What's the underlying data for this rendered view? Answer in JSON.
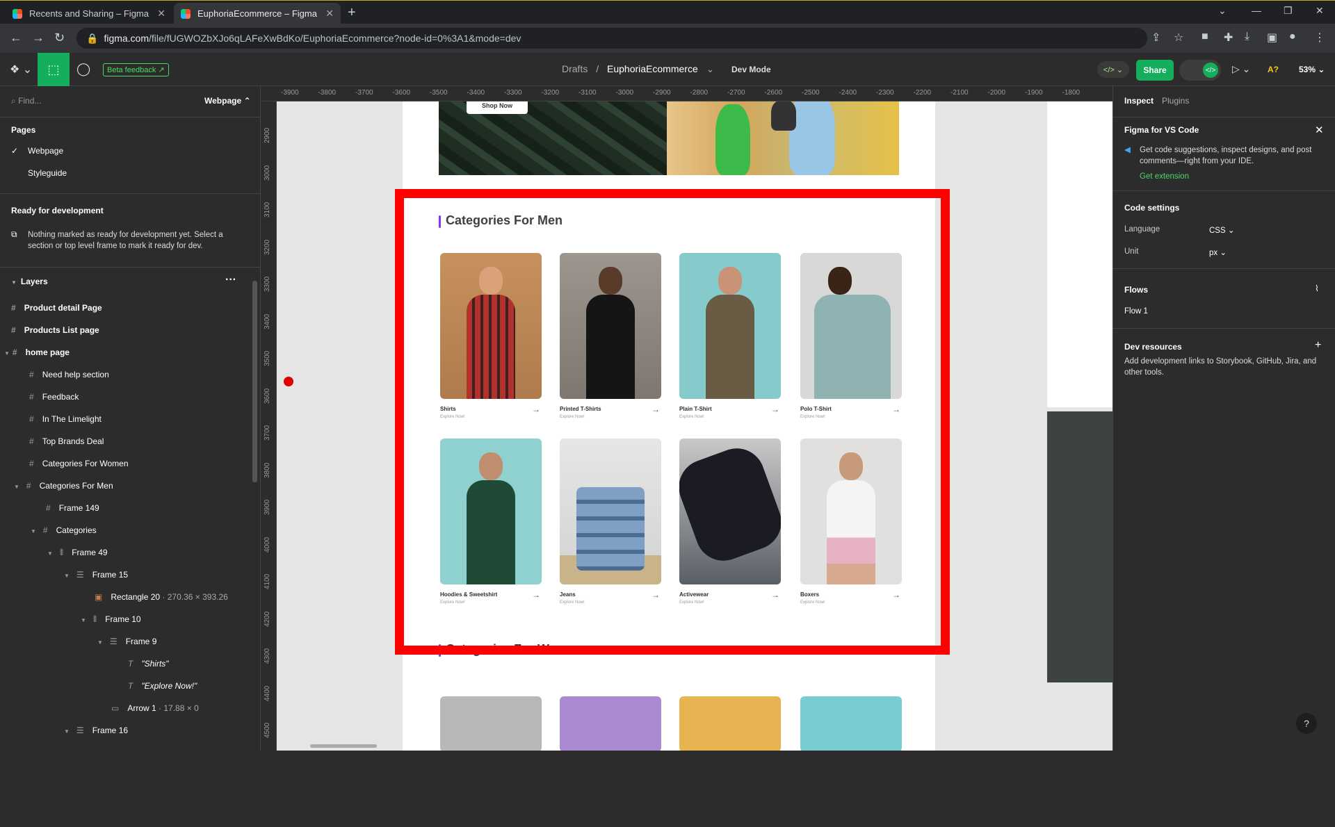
{
  "browser": {
    "tabs": [
      {
        "label": "Recents and Sharing – Figma"
      },
      {
        "label": "EuphoriaEcommerce – Figma"
      }
    ],
    "url_host": "figma.com",
    "url_path": "/file/fUGWOZbXJo6qLAFeXwBdKo/EuphoriaEcommerce?node-id=0%3A1&mode=dev"
  },
  "toolbar": {
    "beta_feedback": "Beta feedback",
    "breadcrumb_drafts": "Drafts",
    "breadcrumb_sep": "/",
    "file_name": "EuphoriaEcommerce",
    "dev_mode": "Dev Mode",
    "share": "Share",
    "zoom": "53%",
    "a11y": "A?"
  },
  "left_panel": {
    "find_placeholder": "Find...",
    "page_dropdown": "Webpage",
    "pages_title": "Pages",
    "pages": [
      "Webpage",
      "Styleguide"
    ],
    "ready_title": "Ready for development",
    "ready_text": "Nothing marked as ready for development yet. Select a section or top level frame to mark it ready for dev.",
    "layers_title": "Layers",
    "layers": [
      {
        "label": "Product detail Page"
      },
      {
        "label": "Products List page"
      },
      {
        "label": "home page"
      },
      {
        "label": "Need help section"
      },
      {
        "label": "Feedback"
      },
      {
        "label": "In The Limelight"
      },
      {
        "label": "Top Brands Deal"
      },
      {
        "label": "Categories For Women"
      },
      {
        "label": "Categories For Men"
      },
      {
        "label": "Frame 149"
      },
      {
        "label": "Categories"
      },
      {
        "label": "Frame 49"
      },
      {
        "label": "Frame 15"
      },
      {
        "label": "Rectangle 20",
        "meta": "· 270.36 × 393.26"
      },
      {
        "label": "Frame 10"
      },
      {
        "label": "Frame 9"
      },
      {
        "label": "\"Shirts\""
      },
      {
        "label": "\"Explore Now!\""
      },
      {
        "label": "Arrow 1",
        "meta": "· 17.88 × 0"
      },
      {
        "label": "Frame 16"
      }
    ]
  },
  "rulers": {
    "top": [
      "-3900",
      "-3800",
      "-3700",
      "-3600",
      "-3500",
      "-3400",
      "-3300",
      "-3200",
      "-3100",
      "-3000",
      "-2900",
      "-2800",
      "-2700",
      "-2600",
      "-2500",
      "-2400",
      "-2300",
      "-2200",
      "-2100",
      "-2000",
      "-1900",
      "-1800"
    ],
    "left": [
      "2900",
      "3000",
      "3100",
      "3200",
      "3300",
      "3400",
      "3500",
      "3600",
      "3700",
      "3800",
      "3900",
      "4000",
      "4100",
      "4200",
      "4300",
      "4400",
      "4500"
    ]
  },
  "canvas": {
    "shop_now": "Shop Now",
    "men_title": "Categories For Men",
    "women_title": "Categories For Women",
    "explore": "Explore Now!",
    "men_cards": [
      {
        "name": "Shirts"
      },
      {
        "name": "Printed T-Shirts"
      },
      {
        "name": "Plain T-Shirt"
      },
      {
        "name": "Polo T-Shirt"
      },
      {
        "name": "Hoodies & Sweetshirt"
      },
      {
        "name": "Jeans"
      },
      {
        "name": "Activewear"
      },
      {
        "name": "Boxers"
      }
    ]
  },
  "right_panel": {
    "tab_inspect": "Inspect",
    "tab_plugins": "Plugins",
    "vscode_title": "Figma for VS Code",
    "vscode_text": "Get code suggestions, inspect designs, and post comments—right from your IDE.",
    "vscode_link": "Get extension",
    "code_settings": "Code settings",
    "language_label": "Language",
    "language_value": "CSS",
    "unit_label": "Unit",
    "unit_value": "px",
    "flows_title": "Flows",
    "flow_1": "Flow 1",
    "dev_resources_title": "Dev resources",
    "dev_resources_text": "Add development links to Storybook, GitHub, Jira, and other tools."
  },
  "colors": {
    "figma_green": "#14ae5c",
    "highlight_red": "#ff0000",
    "accent_purple": "#8a33fd"
  }
}
